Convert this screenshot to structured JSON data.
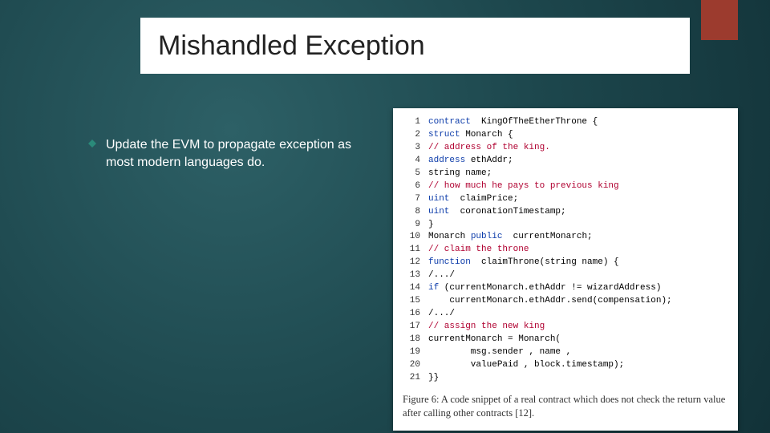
{
  "title": "Mishandled Exception",
  "bullet": {
    "text": "Update the EVM to propagate exception as most modern languages do."
  },
  "code": {
    "lines": [
      {
        "n": "1",
        "kw": "contract",
        "rest": "  KingOfTheEtherThrone {"
      },
      {
        "n": "2",
        "kw": "struct",
        "rest": " Monarch {"
      },
      {
        "n": "3",
        "cm": "// address of the king."
      },
      {
        "n": "4",
        "kw": "address",
        "rest": " ethAddr;"
      },
      {
        "n": "5",
        "plain": "string name;"
      },
      {
        "n": "6",
        "cm": "// how much he pays to previous king"
      },
      {
        "n": "7",
        "kw": "uint",
        "rest": "  claimPrice;"
      },
      {
        "n": "8",
        "kw": "uint",
        "rest": "  coronationTimestamp;"
      },
      {
        "n": "9",
        "plain": "}"
      },
      {
        "n": "10",
        "plain_pre": "Monarch ",
        "kw": "public",
        "rest": "  currentMonarch;"
      },
      {
        "n": "11",
        "cm": "// claim the throne"
      },
      {
        "n": "12",
        "kw": "function",
        "rest": "  claimThrone(string name) {"
      },
      {
        "n": "13",
        "plain": "/.../"
      },
      {
        "n": "14",
        "kw": "if",
        "rest": " (currentMonarch.ethAddr != wizardAddress)"
      },
      {
        "n": "15",
        "plain": "    currentMonarch.ethAddr.send(compensation);"
      },
      {
        "n": "16",
        "plain": "/.../"
      },
      {
        "n": "17",
        "cm": "// assign the new king"
      },
      {
        "n": "18",
        "plain": "currentMonarch = Monarch("
      },
      {
        "n": "19",
        "plain": "        msg.sender , name ,"
      },
      {
        "n": "20",
        "plain": "        valuePaid , block.timestamp);"
      },
      {
        "n": "21",
        "plain": "}}"
      }
    ],
    "caption": "Figure 6: A code snippet of a real contract which does not check the return value after calling other contracts [12]."
  },
  "icons": {
    "bullet": "diamond-bullet-icon"
  }
}
